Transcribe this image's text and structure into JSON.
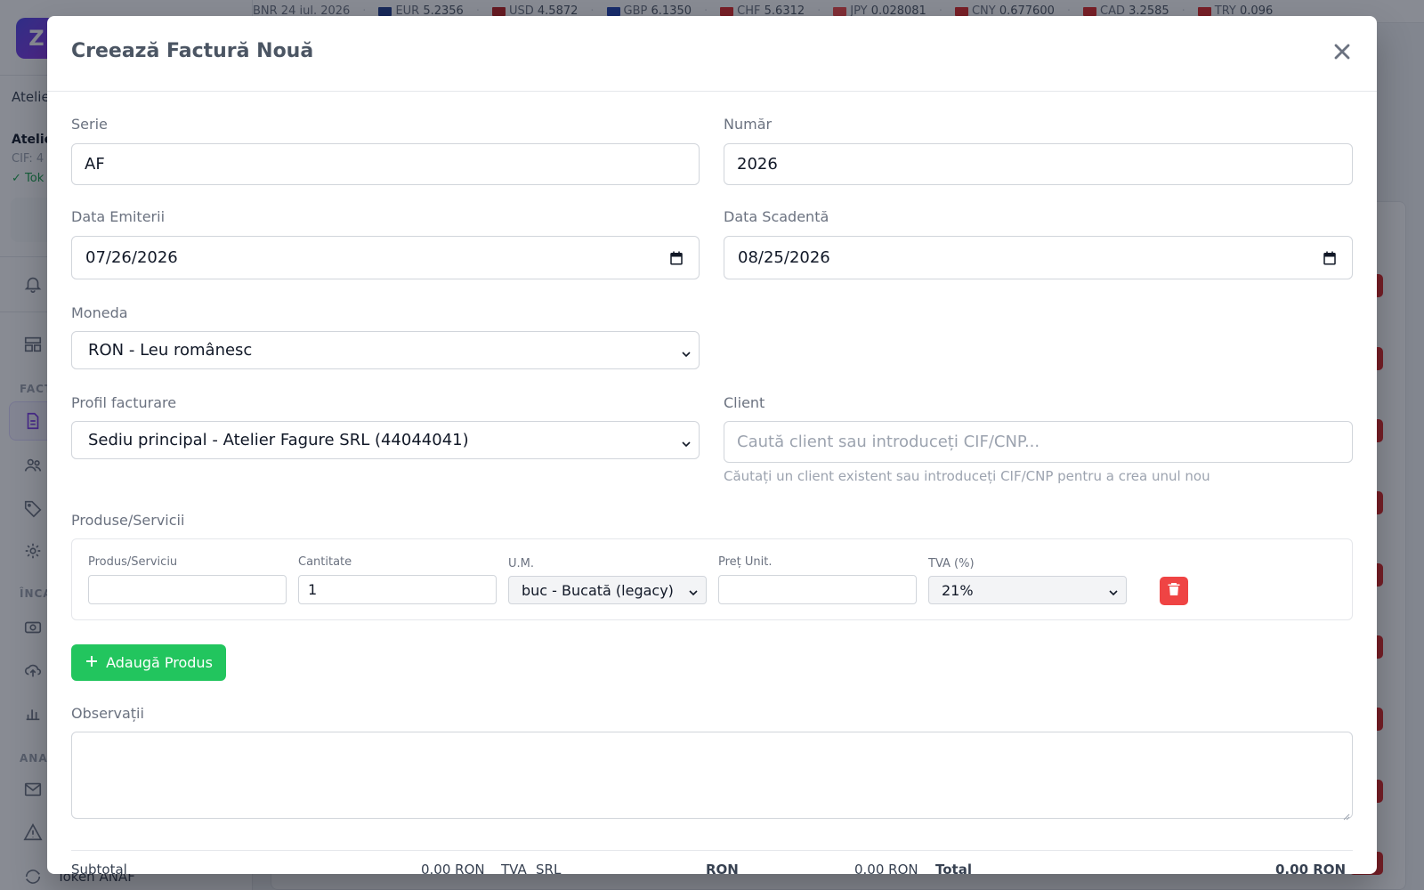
{
  "background": {
    "ticker": {
      "date": "BNR 24 iul. 2026",
      "rates": [
        {
          "code": "EUR",
          "value": "5.2356",
          "flag": "#1e3a8a"
        },
        {
          "code": "USD",
          "value": "4.5872",
          "flag": "#b91c1c"
        },
        {
          "code": "GBP",
          "value": "6.1350",
          "flag": "#1e40af"
        },
        {
          "code": "CHF",
          "value": "5.6312",
          "flag": "#dc2626"
        },
        {
          "code": "JPY",
          "value": "0.028081",
          "flag": "#ef4444"
        },
        {
          "code": "CNY",
          "value": "0.677600",
          "flag": "#dc2626"
        },
        {
          "code": "CAD",
          "value": "3.2585",
          "flag": "#dc2626"
        },
        {
          "code": "TRY",
          "value": "0.096",
          "flag": "#dc2626"
        }
      ]
    },
    "sidebar": {
      "logo_letter": "Z",
      "company_short": "Atelie",
      "company_bold": "Atelie",
      "cif": "CIF: 4",
      "token": "✓ Tok",
      "section_invoicing": "FACT",
      "section_payments": "ÎNCA",
      "section_analytics": "ANA",
      "token_anaf": "Token ANAF"
    }
  },
  "modal": {
    "title": "Creează Factură Nouă",
    "serie": {
      "label": "Serie",
      "value": "AF"
    },
    "numar": {
      "label": "Număr",
      "value": "2026"
    },
    "data_emiterii": {
      "label": "Data Emiterii",
      "value": "07/26/2026"
    },
    "data_scadenta": {
      "label": "Data Scadentă",
      "value": "08/25/2026"
    },
    "moneda": {
      "label": "Moneda",
      "value": "RON - Leu românesc"
    },
    "profil": {
      "label": "Profil facturare",
      "value": "Sediu principal - Atelier Fagure SRL (44044041)"
    },
    "client": {
      "label": "Client",
      "placeholder": "Caută client sau introduceți CIF/CNP...",
      "hint": "Căutați un client existent sau introduceți CIF/CNP pentru a crea unul nou"
    },
    "products": {
      "label": "Produse/Servicii",
      "columns": {
        "product": "Produs/Serviciu",
        "quantity": "Cantitate",
        "unit": "U.M.",
        "price": "Preț Unit.",
        "vat": "TVA (%)"
      },
      "row": {
        "product": "",
        "quantity": "1",
        "unit": "buc - Bucată (legacy)",
        "price": "",
        "vat": "21%"
      },
      "add_label": "Adaugă Produs"
    },
    "observatii": {
      "label": "Observații",
      "value": ""
    },
    "footer": {
      "subtotal_label": "Subtotal",
      "subtotal_value": "0.00 RON",
      "tva_label": "TVA",
      "srl_label": "SRL",
      "currency": "RON",
      "tva_value": "0.00 RON",
      "total_label": "Total",
      "total_value": "0.00 RON"
    }
  }
}
